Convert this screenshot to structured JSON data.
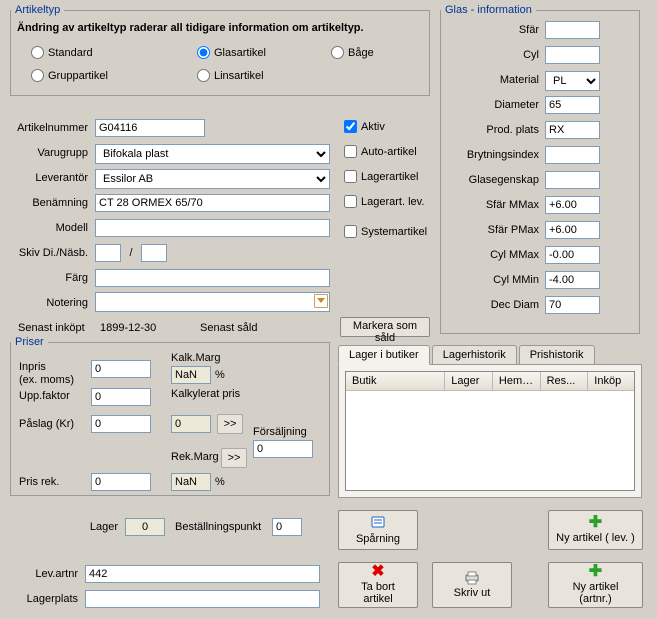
{
  "artikeltyp": {
    "legend": "Artikeltyp",
    "warning": "Ändring av artikeltyp raderar all tidigare information om artikeltyp.",
    "radios": {
      "standard": "Standard",
      "glasartikel": "Glasartikel",
      "bage": "Båge",
      "gruppartikel": "Gruppartikel",
      "linsartikel": "Linsartikel"
    },
    "selected": "glasartikel"
  },
  "fields": {
    "artikelnummer": {
      "label": "Artikelnummer",
      "value": "G04116"
    },
    "varugrupp": {
      "label": "Varugrupp",
      "value": "Bifokala plast"
    },
    "leverantor": {
      "label": "Leverantör",
      "value": "Essilor AB"
    },
    "benamning": {
      "label": "Benämning",
      "value": "CT 28 ORMEX 65/70"
    },
    "modell": {
      "label": "Modell",
      "value": ""
    },
    "skiv": {
      "label": "Skiv Di./Näsb.",
      "a": "",
      "sep": "/",
      "b": ""
    },
    "farg": {
      "label": "Färg",
      "value": ""
    },
    "notering": {
      "label": "Notering",
      "value": ""
    }
  },
  "checks": {
    "aktiv": "Aktiv",
    "auto": "Auto-artikel",
    "lagerartikel": "Lagerartikel",
    "lagerart_lev": "Lagerart. lev.",
    "systemartikel": "Systemartikel",
    "aktiv_checked": true
  },
  "senast": {
    "inkopt_label": "Senast inköpt",
    "inkopt_value": "1899-12-30",
    "sald_label": "Senast såld",
    "markera_btn": "Markera som såld"
  },
  "glas": {
    "legend": "Glas - information",
    "rows": {
      "sfar": {
        "label": "Sfär",
        "value": ""
      },
      "cyl": {
        "label": "Cyl",
        "value": ""
      },
      "material": {
        "label": "Material",
        "value": "PL"
      },
      "diameter": {
        "label": "Diameter",
        "value": "65"
      },
      "prodplats": {
        "label": "Prod. plats",
        "value": "RX"
      },
      "brytningsindex": {
        "label": "Brytningsindex",
        "value": ""
      },
      "glasegenskap": {
        "label": "Glasegenskap",
        "value": ""
      },
      "sfar_mmax": {
        "label": "Sfär MMax",
        "value": "+6.00"
      },
      "sfar_pmax": {
        "label": "Sfär PMax",
        "value": "+6.00"
      },
      "cyl_mmax": {
        "label": "Cyl MMax",
        "value": "-0.00"
      },
      "cyl_mmin": {
        "label": "Cyl MMin",
        "value": "-4.00"
      },
      "dec_diam": {
        "label": "Dec Diam",
        "value": "70"
      }
    }
  },
  "priser": {
    "legend": "Priser",
    "inpris_label": "Inpris\n(ex. moms)",
    "inpris_line1": "Inpris",
    "inpris_line2": "(ex. moms)",
    "inpris": "0",
    "uppfaktor_label": "Upp.faktor",
    "uppfaktor": "0",
    "paslag_label": "Påslag (Kr)",
    "paslag": "0",
    "kalk_marg_label": "Kalk.Marg",
    "kalk_marg": "NaN",
    "percent1": "%",
    "kalkylerat_pris_label": "Kalkylerat pris",
    "kalkylerat_pris": "0",
    "go1": ">>",
    "forsaljning_label": "Försäljning",
    "forsaljning": "0",
    "rek_marg_label": "Rek.Marg",
    "go2": ">>",
    "pris_rek_label": "Pris rek.",
    "pris_rek": "0",
    "rek_marg": "NaN",
    "percent2": "%"
  },
  "lager": {
    "lager_label": "Lager",
    "lager_value": "0",
    "best_label": "Beställningspunkt",
    "best_value": "0"
  },
  "tabs": {
    "t0": "Lager i butiker",
    "t1": "Lagerhistorik",
    "t2": "Prishistorik",
    "active": 0
  },
  "table": {
    "columns": [
      "Butik",
      "Lager",
      "Heml...",
      "Res...",
      "Inköp"
    ],
    "rows": []
  },
  "bottom": {
    "lev_artnr_label": "Lev.artnr",
    "lev_artnr": "442",
    "lagerplats_label": "Lagerplats",
    "lagerplats": ""
  },
  "buttons": {
    "sparning": "Spårning",
    "ny_lev": "Ny artikel ( lev. )",
    "ta_bort": "Ta bort artikel",
    "skriv_ut": "Skriv ut",
    "ny_artnr": "Ny artikel (artnr.)"
  }
}
